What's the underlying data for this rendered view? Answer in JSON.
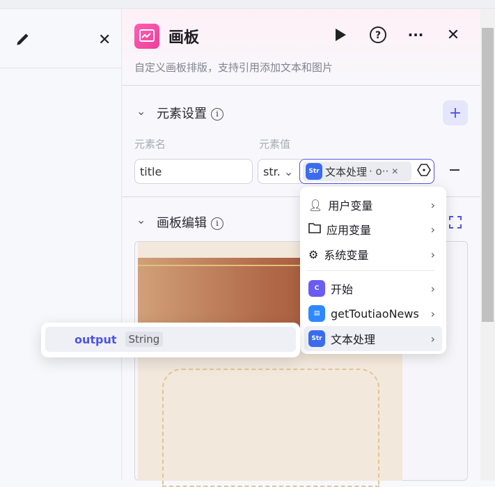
{
  "panel": {
    "title": "画板",
    "description": "自定义画板排版，支持引用添加文本和图片"
  },
  "elements_section": {
    "title": "元素设置",
    "col_name": "元素名",
    "col_value": "元素值",
    "rows": [
      {
        "name": "title",
        "type": "str.",
        "ref_node": "文本处理",
        "ref_suffix": "· o··"
      }
    ]
  },
  "canvas_section": {
    "title": "画板编辑"
  },
  "variable_menu": {
    "items": [
      {
        "label": "用户变量",
        "icon": "user-icon"
      },
      {
        "label": "应用变量",
        "icon": "folder-icon"
      },
      {
        "label": "系统变量",
        "icon": "gear-icon"
      },
      {
        "label": "开始",
        "icon": "start-node-icon",
        "color": "#6a5cf5"
      },
      {
        "label": "getToutiaoNews",
        "icon": "news-node-icon",
        "color": "#2f88ff"
      },
      {
        "label": "文本处理",
        "icon": "str-node-icon",
        "color": "#3b6cf0"
      }
    ]
  },
  "submenu": {
    "field": "output",
    "type": "String"
  },
  "colors": {
    "accent": "#4d53e8",
    "pink": "#f03e9a"
  }
}
